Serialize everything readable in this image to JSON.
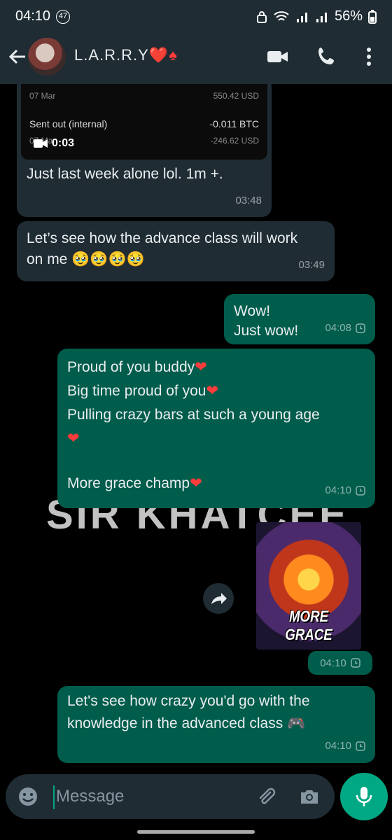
{
  "status_bar": {
    "time": "04:10",
    "notification_count": "47",
    "battery": "56%"
  },
  "header": {
    "contact_name": "L.A.R.R.Y",
    "name_emoji": "❤️♠"
  },
  "watermark": "SIR KHATCEE",
  "video_preview": {
    "date1": "07 Mar",
    "amount1": "550.42 USD",
    "label": "Sent out (internal)",
    "btc": "-0.011 BTC",
    "date2": "07 Mar",
    "usd2": "-246.62 USD",
    "duration": "0:03"
  },
  "messages": [
    {
      "dir": "in",
      "text": "Just last week alone lol. 1m +.",
      "time": "03:48"
    },
    {
      "dir": "in",
      "text": "Let’s see how the advance class will work on me 🥹🥹🥹🥹",
      "time": "03:49"
    },
    {
      "dir": "out",
      "lines": [
        "Wow!",
        "Just wow!"
      ],
      "time": "04:08"
    },
    {
      "dir": "out",
      "lines": [
        "Proud of you buddy",
        "Big time proud of you",
        "Pulling crazy bars at such a young age",
        "More grace champ"
      ],
      "time": "04:10"
    },
    {
      "dir": "out",
      "sticker_text": "MORE GRACE",
      "time": "04:10"
    },
    {
      "dir": "out",
      "text": "Let's see how crazy you'd go with the knowledge in the advanced class 🎮",
      "time": "04:10"
    }
  ],
  "input": {
    "placeholder": "Message"
  },
  "colors": {
    "incoming": "#1f2c34",
    "outgoing": "#005c4b",
    "accent": "#00a884"
  }
}
